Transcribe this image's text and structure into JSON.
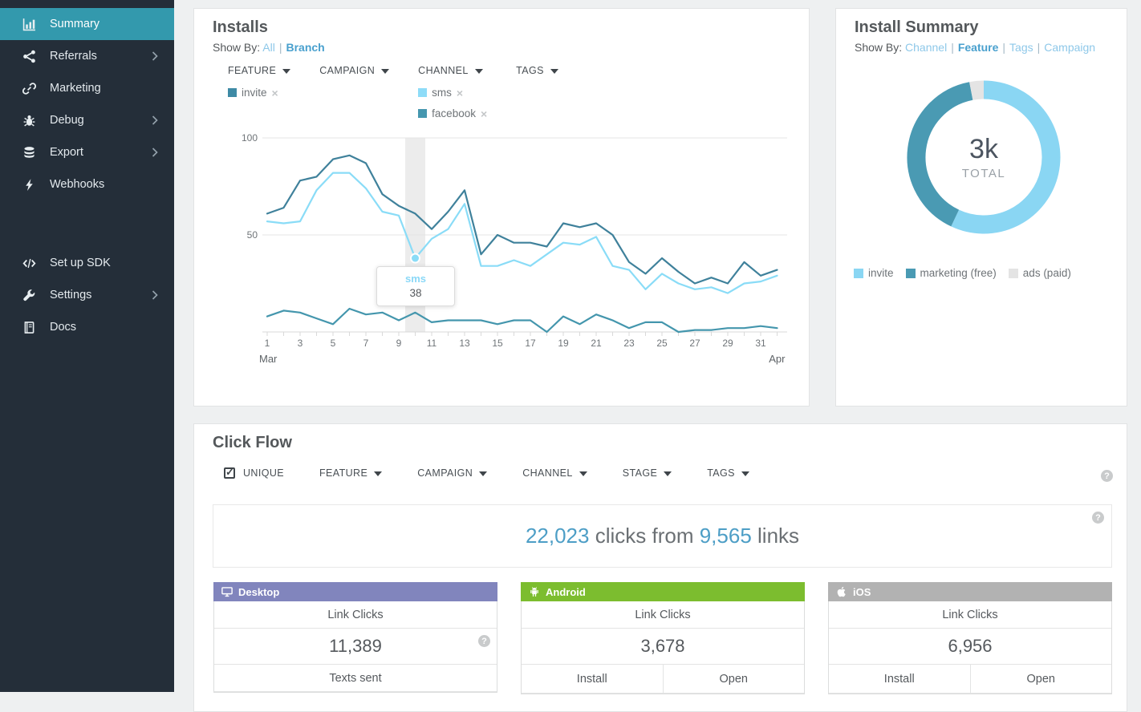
{
  "icons": {
    "help": "?",
    "remove": "×",
    "check": "✓"
  },
  "sidebar": {
    "items": [
      {
        "label": "Summary",
        "icon": "bar-chart",
        "active": true,
        "chevron": false
      },
      {
        "label": "Referrals",
        "icon": "share",
        "active": false,
        "chevron": true
      },
      {
        "label": "Marketing",
        "icon": "link",
        "active": false,
        "chevron": false
      },
      {
        "label": "Debug",
        "icon": "bug",
        "active": false,
        "chevron": true
      },
      {
        "label": "Export",
        "icon": "database",
        "active": false,
        "chevron": true
      },
      {
        "label": "Webhooks",
        "icon": "bolt",
        "active": false,
        "chevron": false
      }
    ],
    "bottom_items": [
      {
        "label": "Set up SDK",
        "icon": "code",
        "active": false,
        "chevron": false
      },
      {
        "label": "Settings",
        "icon": "wrench",
        "active": false,
        "chevron": true
      },
      {
        "label": "Docs",
        "icon": "book",
        "active": false,
        "chevron": false
      }
    ]
  },
  "installs": {
    "title": "Installs",
    "show_by_label": "Show By:",
    "show_by_options": [
      {
        "label": "All",
        "active": false
      },
      {
        "label": "Branch",
        "active": true
      }
    ],
    "filter_columns": [
      {
        "label": "FEATURE",
        "chips": [
          {
            "label": "invite",
            "color": "#3e8aa5"
          }
        ]
      },
      {
        "label": "CAMPAIGN",
        "chips": []
      },
      {
        "label": "CHANNEL",
        "chips": [
          {
            "label": "sms",
            "color": "#8edcf8"
          },
          {
            "label": "facebook",
            "color": "#4597af"
          }
        ]
      },
      {
        "label": "TAGS",
        "chips": []
      }
    ],
    "tooltip": {
      "series": "sms",
      "value": "38"
    }
  },
  "install_summary": {
    "title": "Install Summary",
    "show_by_label": "Show By:",
    "show_by_options": [
      {
        "label": "Channel",
        "active": false
      },
      {
        "label": "Feature",
        "active": true
      },
      {
        "label": "Tags",
        "active": false
      },
      {
        "label": "Campaign",
        "active": false
      }
    ],
    "center_value": "3k",
    "center_label": "TOTAL",
    "legend": [
      {
        "label": "invite",
        "color": "#8ad6f3"
      },
      {
        "label": "marketing (free)",
        "color": "#4a9ab3"
      },
      {
        "label": "ads (paid)",
        "color": "#e4e4e4"
      }
    ]
  },
  "click_flow": {
    "title": "Click Flow",
    "unique": {
      "label": "UNIQUE",
      "checked": true
    },
    "filters": [
      "FEATURE",
      "CAMPAIGN",
      "CHANNEL",
      "STAGE",
      "TAGS"
    ],
    "summary": {
      "clicks": "22,023",
      "mid": " clicks from ",
      "links": "9,565",
      "suffix": " links"
    },
    "platforms": [
      {
        "name": "Desktop",
        "icon": "desktop",
        "header_color": "#8185bd",
        "link_clicks_label": "Link Clicks",
        "link_clicks_value": "11,389",
        "has_help": true,
        "bottom": [
          "Texts sent"
        ]
      },
      {
        "name": "Android",
        "icon": "android",
        "header_color": "#7cbd2f",
        "link_clicks_label": "Link Clicks",
        "link_clicks_value": "3,678",
        "has_help": false,
        "bottom": [
          "Install",
          "Open"
        ]
      },
      {
        "name": "iOS",
        "icon": "apple",
        "header_color": "#b2b2b2",
        "link_clicks_label": "Link Clicks",
        "link_clicks_value": "6,956",
        "has_help": false,
        "bottom": [
          "Install",
          "Open"
        ]
      }
    ]
  },
  "chart_data": [
    {
      "type": "line",
      "title": "Installs",
      "x_label_days": [
        1,
        3,
        5,
        7,
        9,
        11,
        13,
        15,
        17,
        19,
        21,
        23,
        25,
        27,
        29,
        31
      ],
      "month_labels": [
        {
          "label": "Mar",
          "day": 1,
          "anchor": "start"
        },
        {
          "label": "Apr",
          "day": 32,
          "anchor": "end"
        }
      ],
      "days_total": 32,
      "ylim": [
        0,
        100
      ],
      "yticks": [
        50,
        100
      ],
      "grid": true,
      "series": [
        {
          "name": "facebook",
          "color": "#3f819b",
          "values": [
            61,
            64,
            78,
            80,
            89,
            91,
            87,
            71,
            65,
            61,
            53,
            62,
            73,
            40,
            50,
            46,
            46,
            44,
            56,
            54,
            56,
            50,
            36,
            30,
            38,
            31,
            25,
            28,
            25,
            36,
            29,
            32
          ]
        },
        {
          "name": "sms",
          "color": "#8adcf7",
          "values": [
            57,
            56,
            57,
            73,
            82,
            82,
            74,
            62,
            60,
            38,
            48,
            53,
            66,
            34,
            34,
            37,
            34,
            40,
            46,
            45,
            49,
            34,
            32,
            22,
            30,
            25,
            22,
            23,
            20,
            25,
            26,
            29
          ]
        },
        {
          "name": "invite",
          "color": "#4496ad",
          "values": [
            8,
            11,
            10,
            7,
            4,
            12,
            9,
            10,
            6,
            10,
            5,
            6,
            6,
            6,
            4,
            6,
            6,
            0,
            8,
            4,
            9,
            6,
            2,
            5,
            5,
            0,
            1,
            1,
            2,
            2,
            3,
            2
          ]
        }
      ],
      "highlight": {
        "day": 10,
        "series": "sms",
        "value": 38
      }
    },
    {
      "type": "pie",
      "title": "Install Summary",
      "center_value": "3k",
      "center_label": "TOTAL",
      "legend_position": "bottom",
      "segments": [
        {
          "label": "invite",
          "pct": 57,
          "color": "#8ad6f3"
        },
        {
          "label": "marketing (free)",
          "pct": 40,
          "color": "#4a9ab3"
        },
        {
          "label": "ads (paid)",
          "pct": 3,
          "color": "#e4e4e4"
        }
      ]
    }
  ]
}
